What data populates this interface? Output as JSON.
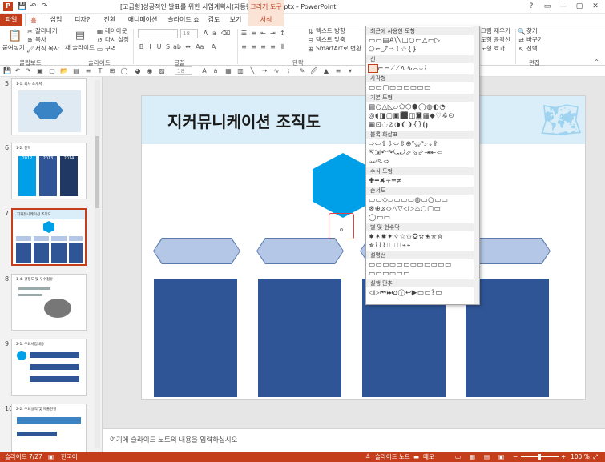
{
  "window": {
    "app_icon": "P",
    "title": "[고급형]성공적인 발표를 위한 사업계획서(자동완성형포함).pptx - PowerPoint",
    "context_tool": "그리기 도구",
    "controls": [
      "?",
      "▭",
      "—",
      "▢",
      "✕"
    ]
  },
  "tabs": [
    "파일",
    "홈",
    "삽입",
    "디자인",
    "전환",
    "애니메이션",
    "슬라이드 쇼",
    "검토",
    "보기",
    "서식"
  ],
  "ribbon": {
    "paste": "붙여넣기",
    "cut": "잘라내기",
    "copy": "복사",
    "format_copy": "서식 복사",
    "new_slide": "새 슬라이드",
    "layout": "레이아웃",
    "reset": "다시 설정",
    "section": "구역",
    "font_size": "18",
    "text_direction": "텍스트 방향",
    "text_align": "텍스트 맞춤",
    "smartart": "SmartArt로 변환",
    "arrange": "그림 재우기",
    "quick_styles": "도형 윤곽선",
    "shape_effects": "도형 효과",
    "find": "찾기",
    "replace": "바꾸기",
    "select": "선택",
    "groups": [
      "클립보드",
      "슬라이드",
      "글꼴",
      "단락",
      "편집"
    ]
  },
  "qat": {
    "font_size": "18"
  },
  "thumbnails": [
    {
      "num": "5",
      "title": "1-1. 회사 소개서"
    },
    {
      "num": "6",
      "title": "1-2. 연혁"
    },
    {
      "num": "7",
      "title": "지커뮤니케이션 조직도"
    },
    {
      "num": "8",
      "title": "1-4. 경쟁도 및 우수점유"
    },
    {
      "num": "9",
      "title": "2-1. 주요사업내용"
    },
    {
      "num": "10",
      "title": "2-2. 주요실적 및 매출현황"
    }
  ],
  "thumb_years": [
    "2012",
    "2013",
    "2014"
  ],
  "slide": {
    "title": "지커뮤니케이션 조직도"
  },
  "gallery": {
    "sections": [
      {
        "title": "최근에 사용한 도형",
        "rows": [
          "▭▭▤A\\╲□○▭△▭▷",
          "⬠⌐⤴⇨⇩☆{}"
        ]
      },
      {
        "title": "선",
        "rows": [
          "╲╲⌐⌐⟋⟋∿∿⌒⌣⌇"
        ]
      },
      {
        "title": "사각형",
        "rows": [
          "▭▭▢▭▭▭▭▭▭"
        ]
      },
      {
        "title": "기본 도형",
        "rows": [
          "▤○△◺▱⬠⬡⬢◯◍◐◔",
          "◎◖◨▢▣⬛◫◙▦◆♡✲⊙",
          "▦⊡◌⊘◑❨❩{}⦗⦘"
        ]
      },
      {
        "title": "블록 화살표",
        "rows": [
          "⇨⇦⇧⇩⬄⇳⊕⤡⤢⤴⤵⇪",
          "⇱⇲↶↷⤿⤾⬀⬂⬃⇥⇤⇦",
          "⤷⤶⬁⬄"
        ]
      },
      {
        "title": "수식 도형",
        "rows": [
          "✚━✖÷═≠"
        ]
      },
      {
        "title": "순서도",
        "rows": [
          "▭▭◇▱▭▭▭◍▭○▭▭",
          "⊗⊕⧖◇△▽◁▷⌓○▢▭",
          "◯▭▭"
        ]
      },
      {
        "title": "별 및 현수막",
        "rows": [
          "✸✶✹✦✧☆✩✪✫✬✭✮",
          "✯⌇⌇⌇⎍⎍⎍⌁⌁"
        ]
      },
      {
        "title": "설명선",
        "rows": [
          "▭▭▭▭▭▭▭▭▭▭▭▭",
          "▭▭▭▭▭▭"
        ]
      },
      {
        "title": "실행 단추",
        "rows": [
          "◁▷⏮⏭⌂ⓘ↩▶▭▭?▭"
        ]
      }
    ]
  },
  "notes": {
    "placeholder": "여기에 슬라이드 노트의 내용을 입력하십시오"
  },
  "status": {
    "slide_count": "슬라이드 7/27",
    "language": "한국어",
    "notes": "슬라이드 노트",
    "memo": "메모",
    "zoom": "100 %"
  }
}
